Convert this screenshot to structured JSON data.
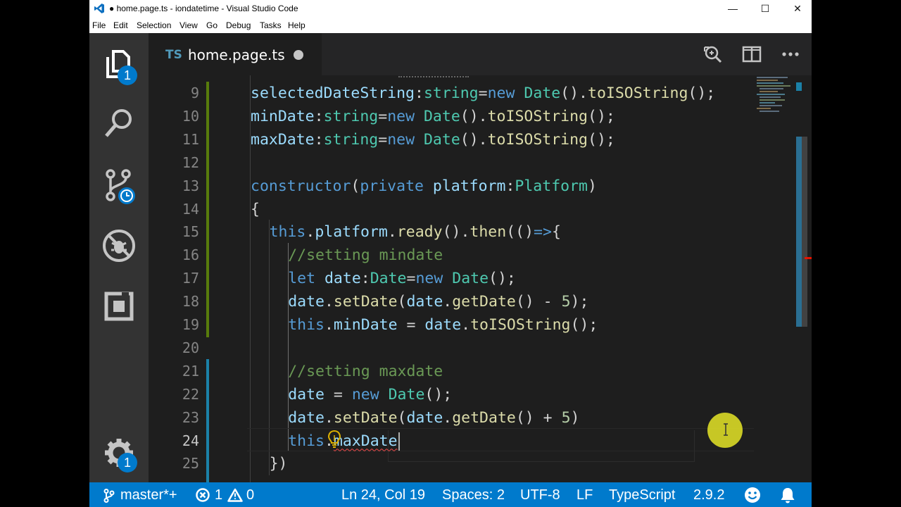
{
  "window": {
    "title": "● home.page.ts - iondatetime - Visual Studio Code",
    "controls": {
      "minimize": "—",
      "maximize": "☐",
      "close": "✕"
    }
  },
  "menu": [
    "File",
    "Edit",
    "Selection",
    "View",
    "Go",
    "Debug",
    "Tasks",
    "Help"
  ],
  "activity_bar": {
    "explorer_badge": "1",
    "settings_badge": "1",
    "icons": [
      "files-icon",
      "search-icon",
      "source-control-icon",
      "debug-icon",
      "extensions-icon",
      "gear-icon"
    ]
  },
  "tab": {
    "lang_badge": "TS",
    "file_name": "home.page.ts",
    "dirty": true
  },
  "editor": {
    "lines": [
      {
        "n": "9",
        "indent": 0,
        "tokens": [
          [
            "vr",
            "selectedDateString"
          ],
          [
            "p",
            ":"
          ],
          [
            "ty",
            "string"
          ],
          [
            "p",
            "="
          ],
          [
            "kw",
            "new"
          ],
          [
            "p",
            " "
          ],
          [
            "ty",
            "Date"
          ],
          [
            "p",
            "()."
          ],
          [
            "fn",
            "toISOString"
          ],
          [
            "p",
            "();"
          ]
        ]
      },
      {
        "n": "10",
        "indent": 0,
        "tokens": [
          [
            "vr",
            "minDate"
          ],
          [
            "p",
            ":"
          ],
          [
            "ty",
            "string"
          ],
          [
            "p",
            "="
          ],
          [
            "kw",
            "new"
          ],
          [
            "p",
            " "
          ],
          [
            "ty",
            "Date"
          ],
          [
            "p",
            "()."
          ],
          [
            "fn",
            "toISOString"
          ],
          [
            "p",
            "();"
          ]
        ]
      },
      {
        "n": "11",
        "indent": 0,
        "tokens": [
          [
            "vr",
            "maxDate"
          ],
          [
            "p",
            ":"
          ],
          [
            "ty",
            "string"
          ],
          [
            "p",
            "="
          ],
          [
            "kw",
            "new"
          ],
          [
            "p",
            " "
          ],
          [
            "ty",
            "Date"
          ],
          [
            "p",
            "()."
          ],
          [
            "fn",
            "toISOString"
          ],
          [
            "p",
            "();"
          ]
        ]
      },
      {
        "n": "12",
        "indent": 0,
        "tokens": []
      },
      {
        "n": "13",
        "indent": 0,
        "tokens": [
          [
            "kw",
            "constructor"
          ],
          [
            "p",
            "("
          ],
          [
            "kw",
            "private"
          ],
          [
            "p",
            " "
          ],
          [
            "vr",
            "platform"
          ],
          [
            "p",
            ":"
          ],
          [
            "ty",
            "Platform"
          ],
          [
            "p",
            ")"
          ]
        ]
      },
      {
        "n": "14",
        "indent": 0,
        "tokens": [
          [
            "p",
            "{"
          ]
        ]
      },
      {
        "n": "15",
        "indent": 1,
        "tokens": [
          [
            "kw",
            "this"
          ],
          [
            "p",
            "."
          ],
          [
            "vr",
            "platform"
          ],
          [
            "p",
            "."
          ],
          [
            "fn",
            "ready"
          ],
          [
            "p",
            "()."
          ],
          [
            "fn",
            "then"
          ],
          [
            "p",
            "(()"
          ],
          [
            "kw",
            "=>"
          ],
          [
            "p",
            "{"
          ]
        ]
      },
      {
        "n": "16",
        "indent": 2,
        "tokens": [
          [
            "cm",
            "//setting mindate"
          ]
        ]
      },
      {
        "n": "17",
        "indent": 2,
        "tokens": [
          [
            "kw",
            "let"
          ],
          [
            "p",
            " "
          ],
          [
            "vr",
            "date"
          ],
          [
            "p",
            ":"
          ],
          [
            "ty",
            "Date"
          ],
          [
            "p",
            "="
          ],
          [
            "kw",
            "new"
          ],
          [
            "p",
            " "
          ],
          [
            "ty",
            "Date"
          ],
          [
            "p",
            "();"
          ]
        ]
      },
      {
        "n": "18",
        "indent": 2,
        "tokens": [
          [
            "vr",
            "date"
          ],
          [
            "p",
            "."
          ],
          [
            "fn",
            "setDate"
          ],
          [
            "p",
            "("
          ],
          [
            "vr",
            "date"
          ],
          [
            "p",
            "."
          ],
          [
            "fn",
            "getDate"
          ],
          [
            "p",
            "() - "
          ],
          [
            "nm",
            "5"
          ],
          [
            "p",
            ");"
          ]
        ]
      },
      {
        "n": "19",
        "indent": 2,
        "tokens": [
          [
            "kw",
            "this"
          ],
          [
            "p",
            "."
          ],
          [
            "vr",
            "minDate"
          ],
          [
            "p",
            " = "
          ],
          [
            "vr",
            "date"
          ],
          [
            "p",
            "."
          ],
          [
            "fn",
            "toISOString"
          ],
          [
            "p",
            "();"
          ]
        ]
      },
      {
        "n": "20",
        "indent": 0,
        "tokens": []
      },
      {
        "n": "21",
        "indent": 2,
        "tokens": [
          [
            "cm",
            "//setting maxdate"
          ]
        ]
      },
      {
        "n": "22",
        "indent": 2,
        "tokens": [
          [
            "vr",
            "date"
          ],
          [
            "p",
            " = "
          ],
          [
            "kw",
            "new"
          ],
          [
            "p",
            " "
          ],
          [
            "ty",
            "Date"
          ],
          [
            "p",
            "();"
          ]
        ]
      },
      {
        "n": "23",
        "indent": 2,
        "tokens": [
          [
            "vr",
            "date"
          ],
          [
            "p",
            "."
          ],
          [
            "fn",
            "setDate"
          ],
          [
            "p",
            "("
          ],
          [
            "vr",
            "date"
          ],
          [
            "p",
            "."
          ],
          [
            "fn",
            "getDate"
          ],
          [
            "p",
            "() + "
          ],
          [
            "nm",
            "5"
          ],
          [
            "p",
            ")"
          ]
        ]
      },
      {
        "n": "24",
        "indent": 2,
        "tokens": [
          [
            "kw",
            "this"
          ],
          [
            "p",
            "."
          ],
          [
            "sq",
            "maxDate"
          ]
        ]
      },
      {
        "n": "25",
        "indent": 1,
        "tokens": [
          [
            "p",
            "})"
          ]
        ]
      }
    ],
    "current_line": "24"
  },
  "status_bar": {
    "branch": "master*+",
    "errors": "1",
    "warnings": "0",
    "position": "Ln 24, Col 19",
    "spaces": "Spaces: 2",
    "encoding": "UTF-8",
    "eol": "LF",
    "language": "TypeScript",
    "version": "2.9.2"
  },
  "colors": {
    "accent": "#007acc",
    "editor_bg": "#1e1e1e",
    "added_line": "#587c0c",
    "modified_line": "#1b81a8"
  }
}
